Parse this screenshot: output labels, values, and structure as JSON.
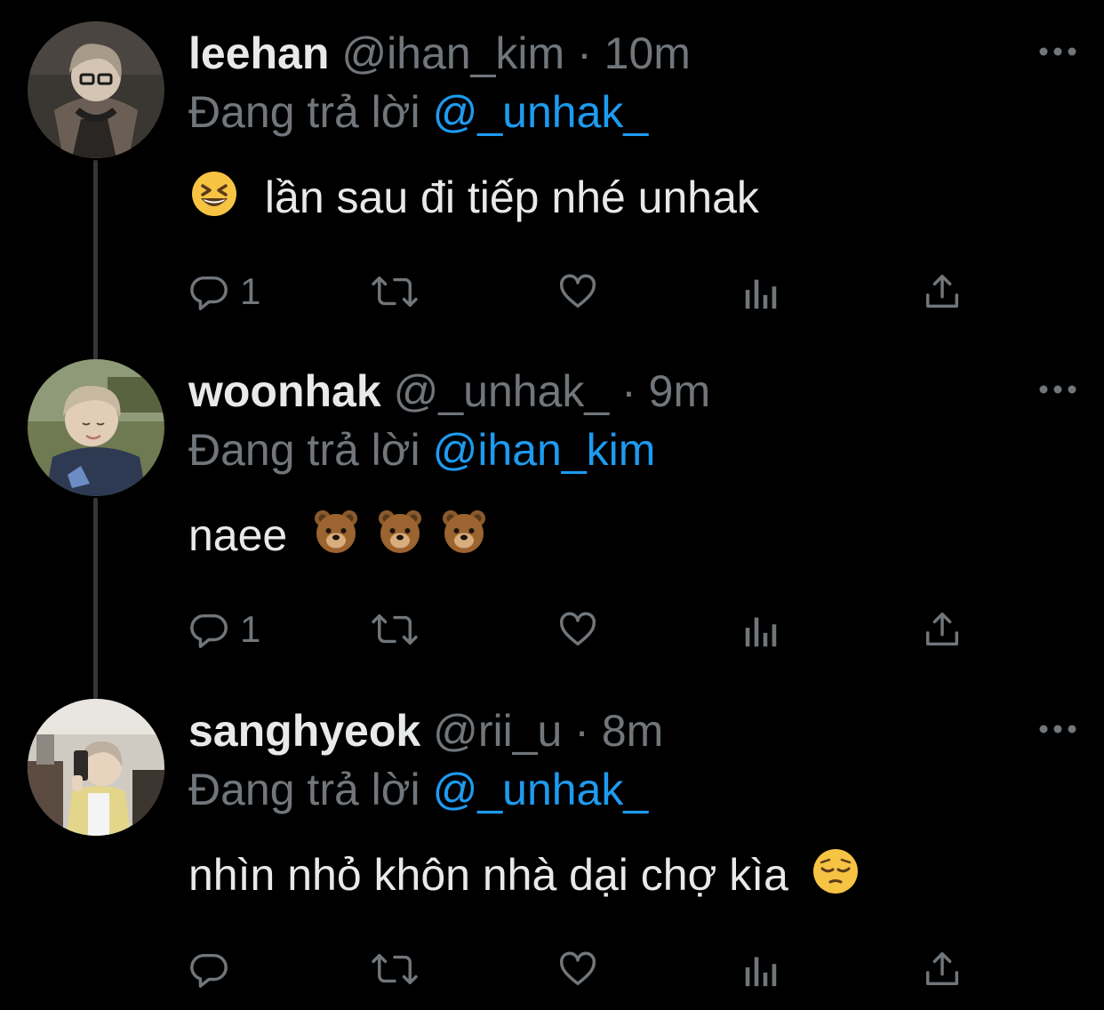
{
  "tweets": [
    {
      "display_name": "leehan",
      "handle": "@ihan_kim",
      "separator": "·",
      "time": "10m",
      "reply_prefix": "Đang trả lời",
      "reply_to": "@_unhak_",
      "text_before_emoji": "",
      "text": "lần sau đi tiếp nhé unhak",
      "emoji_lead": "grinning-squinting-face",
      "reply_count": "1",
      "avatar_colors": [
        "#2b2b2b",
        "#8c8173",
        "#d8d0c6"
      ]
    },
    {
      "display_name": "woonhak",
      "handle": "@_unhak_",
      "separator": "·",
      "time": "9m",
      "reply_prefix": "Đang trả lời",
      "reply_to": "@ihan_kim",
      "text": "naee",
      "emoji_trail": [
        "bear-face",
        "bear-face",
        "bear-face"
      ],
      "reply_count": "1",
      "avatar_colors": [
        "#5d6b3c",
        "#c9c2b3",
        "#2f3a4d"
      ]
    },
    {
      "display_name": "sanghyeok",
      "handle": "@rii_u",
      "separator": "·",
      "time": "8m",
      "reply_prefix": "Đang trả lời",
      "reply_to": "@_unhak_",
      "text": "nhìn nhỏ khôn nhà dại chợ kìa",
      "emoji_trail": [
        "pensive-face"
      ],
      "reply_count": "",
      "avatar_colors": [
        "#d9d6cf",
        "#e6d98a",
        "#3b3430"
      ]
    }
  ],
  "colors": {
    "background": "#000000",
    "primary_text": "#e7e9ea",
    "secondary_text": "#71767b",
    "link": "#1d9bf0",
    "thread_line": "#333639"
  },
  "icons": {
    "reply": "reply-icon",
    "retweet": "retweet-icon",
    "like": "like-icon",
    "views": "views-icon",
    "share": "share-icon",
    "more": "more-icon"
  }
}
